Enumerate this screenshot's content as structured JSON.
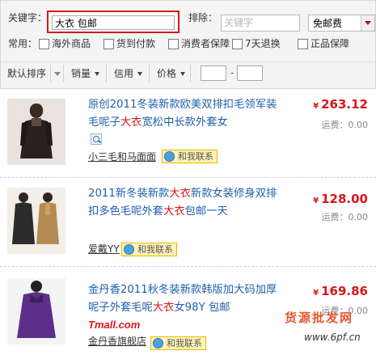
{
  "search": {
    "keyword_label": "关键字：",
    "keyword_value": "大衣 包邮",
    "exclude_label": "排除：",
    "exclude_placeholder": "关键字",
    "shipping_select": "免邮费"
  },
  "filters": {
    "label": "常用：",
    "options": [
      "海外商品",
      "货到付款",
      "消费者保障",
      "7天退换",
      "正品保障"
    ]
  },
  "sort": {
    "default": "默认排序",
    "sales": "销量",
    "credit": "信用",
    "price": "价格",
    "range_dash": "-"
  },
  "items": [
    {
      "title_parts": [
        "原创2011冬装新款欧美双排扣毛领军装毛呢子",
        "大衣",
        "宽松中长款外套女"
      ],
      "shop": "小三毛和马面面",
      "contact": "和我联系",
      "price": "263.12",
      "currency": "¥",
      "shipping": "运费：0.00"
    },
    {
      "title_parts": [
        "2011新冬装新款",
        "大衣",
        "新款女装修身双排扣多色毛呢外套",
        "大衣",
        "包邮一天"
      ],
      "shop": "爱戴YY",
      "contact": "和我联系",
      "price": "128.00",
      "currency": "¥",
      "shipping": "运费：0.00"
    },
    {
      "title_parts": [
        "金丹香2011秋冬装新款韩版加大码加厚呢子外套毛呢",
        "大衣",
        "女98Y 包邮"
      ],
      "tmall": "Tmall.com",
      "shop": "金丹香旗舰店",
      "contact": "和我联系",
      "price": "169.86",
      "currency": "¥",
      "shipping": "运费：0.00"
    }
  ],
  "watermark": {
    "text": "货源批发网",
    "url": "www.6pf.cn"
  },
  "colors": {
    "accent_red": "#d9151b",
    "link_blue": "#1f5fad"
  }
}
